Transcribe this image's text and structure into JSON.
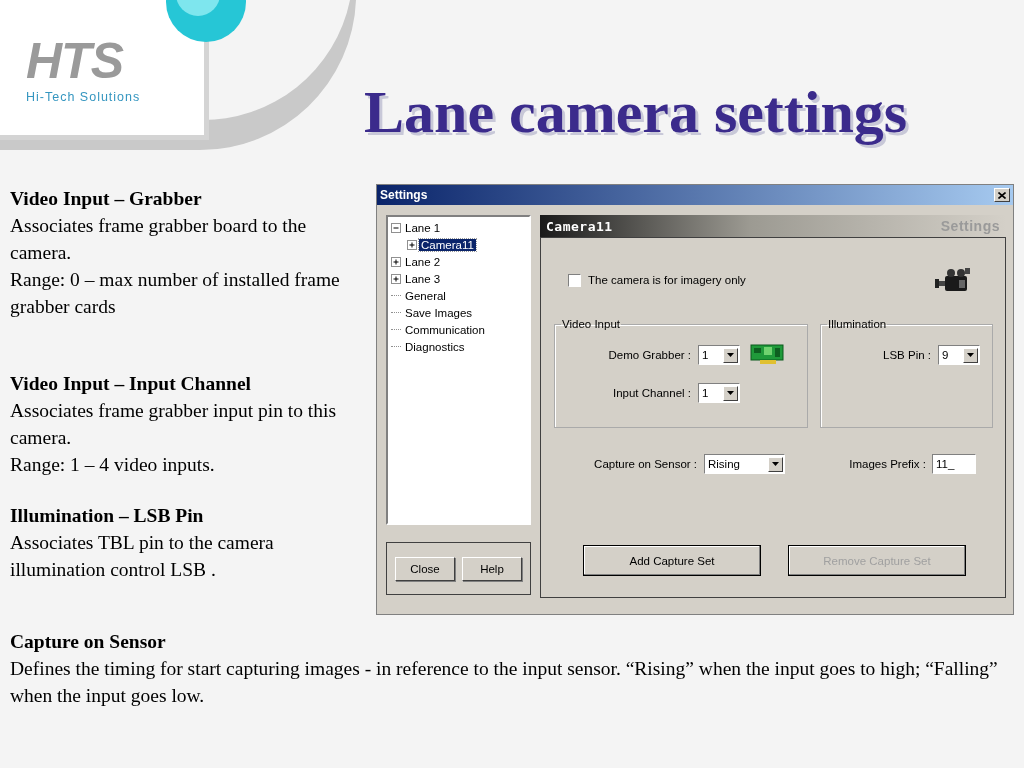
{
  "slide": {
    "logo": {
      "mark": "HTS",
      "tagline": "Hi-Tech Solutions"
    },
    "title": "Lane camera settings"
  },
  "notes": [
    {
      "heading": "Video Input – Grabber",
      "lines": [
        "Associates frame grabber board to the camera.",
        "Range: 0 – max number of installed frame grabber cards"
      ]
    },
    {
      "heading": "Video Input – Input Channel",
      "lines": [
        "Associates frame grabber input pin to this camera.",
        "Range: 1 – 4 video inputs."
      ]
    },
    {
      "heading": "Illumination – LSB Pin",
      "lines": [
        "Associates TBL pin to the camera illumination control LSB ."
      ]
    }
  ],
  "bottom_note": {
    "heading": "Capture on Sensor",
    "lines": [
      "Defines the timing for start capturing images - in reference to the input sensor. “Rising” when the input goes to high; “Falling” when the input goes low."
    ]
  },
  "window": {
    "title": "Settings",
    "tree": [
      {
        "label": "Lane 1",
        "selected": false,
        "expanded": true,
        "children": [
          {
            "label": "Camera11",
            "selected": true,
            "expanded": false
          }
        ]
      },
      {
        "label": "Lane 2",
        "selected": false,
        "expanded": false
      },
      {
        "label": "Lane 3",
        "selected": false,
        "expanded": false
      },
      {
        "label": "General",
        "selected": false
      },
      {
        "label": "Save Images",
        "selected": false
      },
      {
        "label": "Communication",
        "selected": false
      },
      {
        "label": "Diagnostics",
        "selected": false
      }
    ],
    "footer_buttons": [
      "Close",
      "Help"
    ],
    "panel": {
      "name": "Camera11",
      "caption": "Settings",
      "imagery_only": {
        "label": "The camera is for imagery only",
        "checked": false
      },
      "video_input": {
        "title": "Video Input",
        "fields": [
          {
            "label": "Demo Grabber :",
            "value": "1"
          },
          {
            "label": "Input Channel :",
            "value": "1"
          }
        ]
      },
      "illumination": {
        "title": "Illumination",
        "fields": [
          {
            "label": "LSB Pin :",
            "value": "9"
          }
        ]
      },
      "capture_on_sensor": {
        "label": "Capture on Sensor :",
        "value": "Rising"
      },
      "images_prefix": {
        "label": "Images Prefix :",
        "value": "11_"
      },
      "buttons": [
        {
          "label": "Add Capture Set",
          "disabled": false
        },
        {
          "label": "Remove Capture Set",
          "disabled": true
        }
      ]
    }
  }
}
